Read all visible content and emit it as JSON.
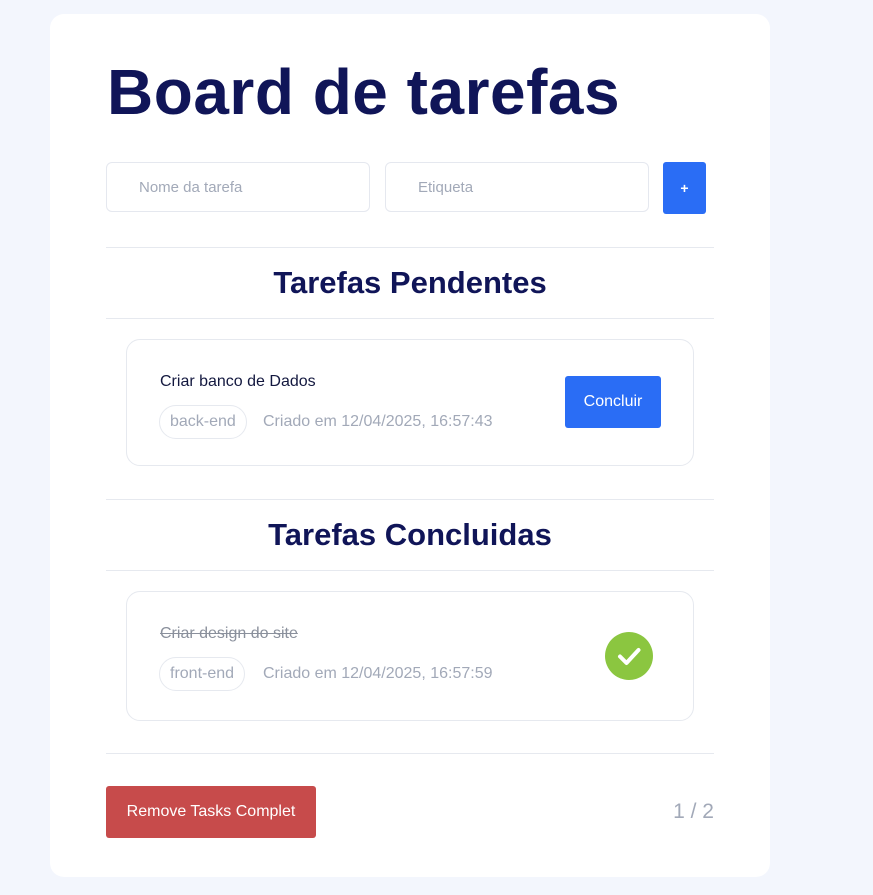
{
  "header": {
    "title": "Board de tarefas"
  },
  "form": {
    "name_placeholder": "Nome da tarefa",
    "tag_placeholder": "Etiqueta",
    "add_label": "+"
  },
  "pending": {
    "title": "Tarefas Pendentes",
    "tasks": [
      {
        "name": "Criar banco de Dados",
        "tag": "back-end",
        "created": "Criado em 12/04/2025, 16:57:43",
        "action_label": "Concluir"
      }
    ]
  },
  "completed": {
    "title": "Tarefas Concluidas",
    "tasks": [
      {
        "name": "Criar design do site",
        "tag": "front-end",
        "created": "Criado em 12/04/2025, 16:57:59",
        "status_icon": "check-icon"
      }
    ]
  },
  "footer": {
    "remove_label": "Remove Tasks Complet",
    "pagination": "1 / 2"
  },
  "colors": {
    "primary": "#2a6df5",
    "heading": "#101558",
    "danger": "#c74b4b",
    "success": "#8bc640",
    "background": "#f3f6fd"
  }
}
